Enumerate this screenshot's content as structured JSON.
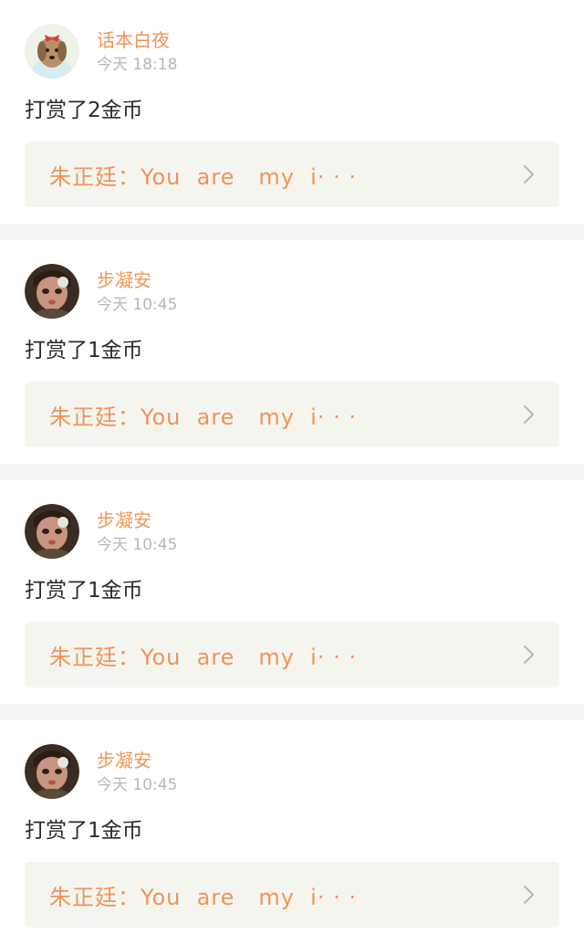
{
  "feed": {
    "items": [
      {
        "user": "话本白夜",
        "time": "今天 18:18",
        "action": "打赏了2金币",
        "quote": "朱正廷：You  are   my  i· · ·",
        "avatar": "avatar-dog"
      },
      {
        "user": "步凝安",
        "time": "今天 10:45",
        "action": "打赏了1金币",
        "quote": "朱正廷：You  are   my  i· · ·",
        "avatar": "avatar-girl"
      },
      {
        "user": "步凝安",
        "time": "今天 10:45",
        "action": "打赏了1金币",
        "quote": "朱正廷：You  are   my  i· · ·",
        "avatar": "avatar-girl"
      },
      {
        "user": "步凝安",
        "time": "今天 10:45",
        "action": "打赏了1金币",
        "quote": "朱正廷：You  are   my  i· · ·",
        "avatar": "avatar-girl"
      }
    ]
  },
  "colors": {
    "accent": "#f0945a",
    "timestamp": "#b8b8b8",
    "quote_bg": "#f5f5f0",
    "separator": "#f4f4f4"
  },
  "icons": {
    "chevron": "chevron-right-icon"
  }
}
